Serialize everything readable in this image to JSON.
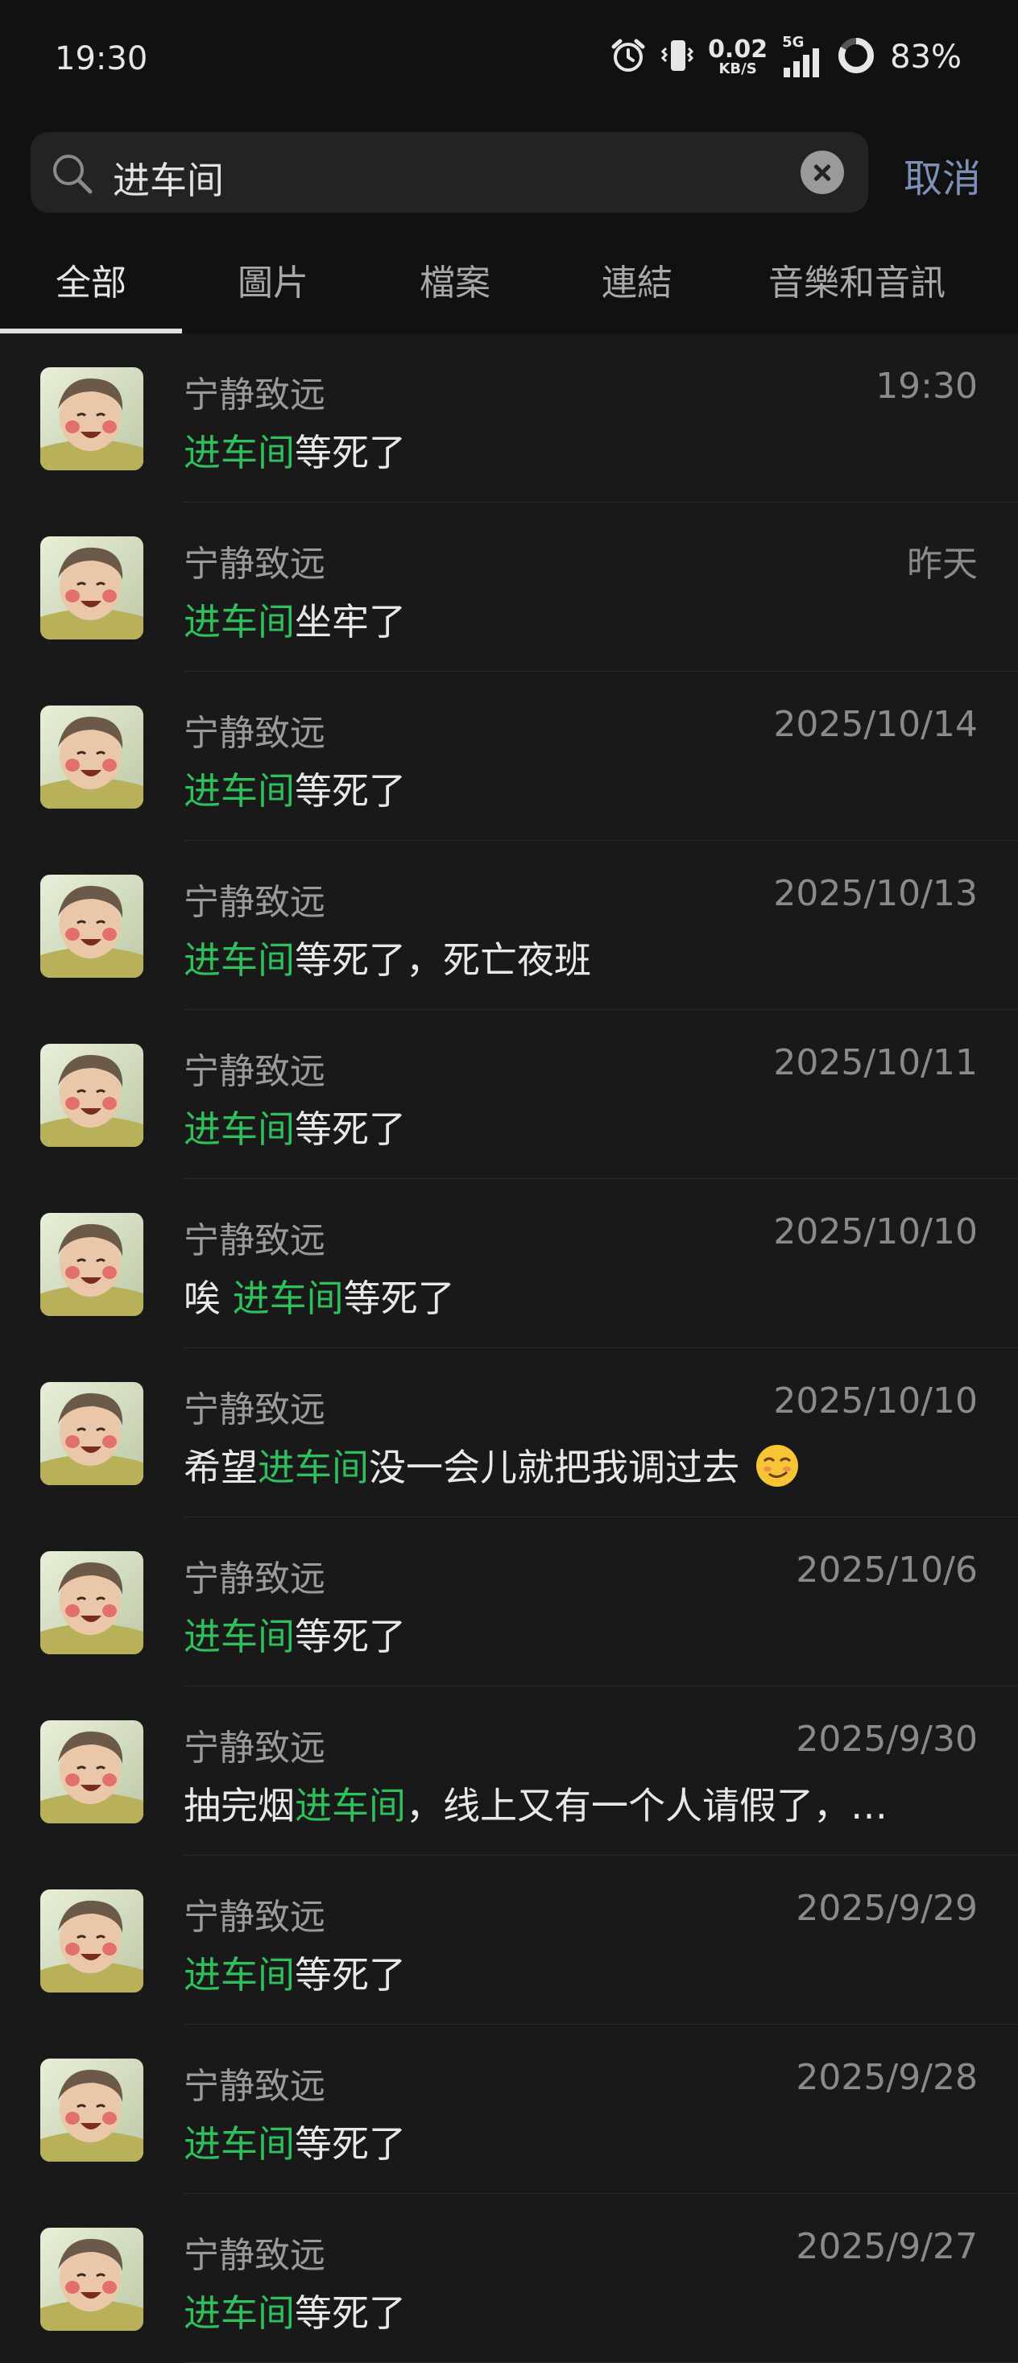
{
  "status_bar": {
    "time": "19:30",
    "net_speed": "0.02",
    "net_unit": "KB/S",
    "network_type": "5G",
    "battery_pct": "83%",
    "icons": [
      "alarm-icon",
      "vibrate-icon",
      "signal-icon",
      "battery-ring-icon"
    ]
  },
  "search": {
    "query": "进车间",
    "cancel_label": "取消",
    "icon": "search-icon"
  },
  "tabs": [
    {
      "label": "全部",
      "active": true
    },
    {
      "label": "圖片",
      "active": false
    },
    {
      "label": "檔案",
      "active": false
    },
    {
      "label": "連結",
      "active": false
    },
    {
      "label": "音樂和音訊",
      "active": false
    }
  ],
  "colors": {
    "highlight": "#2fbf5c",
    "accent": "#7d91b8",
    "background": "#191919"
  },
  "results": [
    {
      "name": "宁静致远",
      "date": "19:30",
      "pre": "",
      "hl": "进车间",
      "post": "等死了"
    },
    {
      "name": "宁静致远",
      "date": "昨天",
      "pre": "",
      "hl": "进车间",
      "post": "坐牢了"
    },
    {
      "name": "宁静致远",
      "date": "2025/10/14",
      "pre": "",
      "hl": "进车间",
      "post": "等死了"
    },
    {
      "name": "宁静致远",
      "date": "2025/10/13",
      "pre": "",
      "hl": "进车间",
      "post": "等死了，死亡夜班"
    },
    {
      "name": "宁静致远",
      "date": "2025/10/11",
      "pre": "",
      "hl": "进车间",
      "post": "等死了"
    },
    {
      "name": "宁静致远",
      "date": "2025/10/10",
      "pre": "唉 ",
      "hl": "进车间",
      "post": "等死了"
    },
    {
      "name": "宁静致远",
      "date": "2025/10/10",
      "pre": "希望",
      "hl": "进车间",
      "post": "没一会儿就把我调过去",
      "emoji": "smirk-emoji"
    },
    {
      "name": "宁静致远",
      "date": "2025/10/6",
      "pre": "",
      "hl": "进车间",
      "post": "等死了"
    },
    {
      "name": "宁静致远",
      "date": "2025/9/30",
      "pre": "抽完烟",
      "hl": "进车间",
      "post": "，线上又有一个人请假了，…"
    },
    {
      "name": "宁静致远",
      "date": "2025/9/29",
      "pre": "",
      "hl": "进车间",
      "post": "等死了"
    },
    {
      "name": "宁静致远",
      "date": "2025/9/28",
      "pre": "",
      "hl": "进车间",
      "post": "等死了"
    },
    {
      "name": "宁静致远",
      "date": "2025/9/27",
      "pre": "",
      "hl": "进车间",
      "post": "等死了"
    }
  ]
}
